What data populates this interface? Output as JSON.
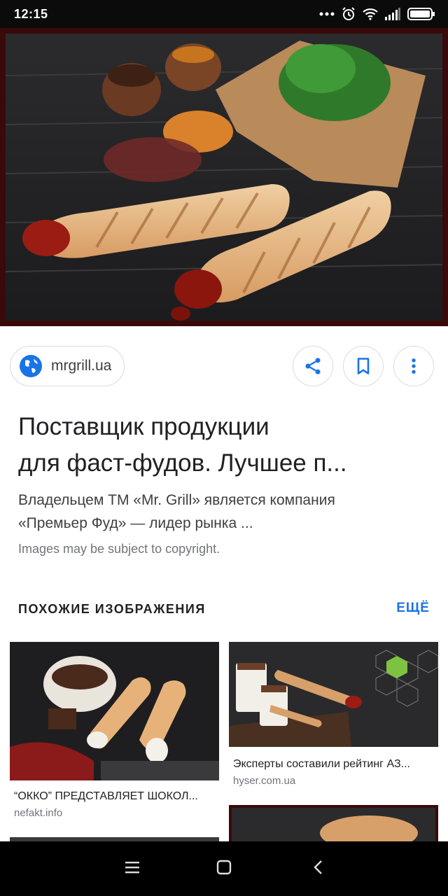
{
  "status_bar": {
    "time": "12:15",
    "battery_icon": "battery-icon",
    "signal_icon": "signal-icon",
    "wifi_icon": "wifi-icon",
    "alarm_icon": "alarm-icon"
  },
  "source": {
    "domain": "mrgrill.ua"
  },
  "result": {
    "title_line1": "Поставщик продукции",
    "title_line2": "для фаст-фудов. Лучшее п...",
    "snippet_line1": "Владельцем ТМ «Mr. Grill» является компания",
    "snippet_line2": "«Премьер Фуд» — лидер рынка ...",
    "copyright": "Images may be subject to copyright."
  },
  "related": {
    "heading": "ПОХОЖИЕ ИЗОБРАЖЕНИЯ",
    "more": "ЕЩЁ",
    "items": [
      {
        "caption": "“ОККО” ПРЕДСТАВЛЯЕТ ШОКОЛ...",
        "source": "nefakt.info"
      },
      {
        "caption": "Эксперты составили рейтинг АЗ...",
        "source": "hyser.com.ua"
      }
    ]
  },
  "colors": {
    "accent": "#1a73e8",
    "hero_border": "#3a0a0a",
    "status_bar": "#0b0b0b"
  }
}
